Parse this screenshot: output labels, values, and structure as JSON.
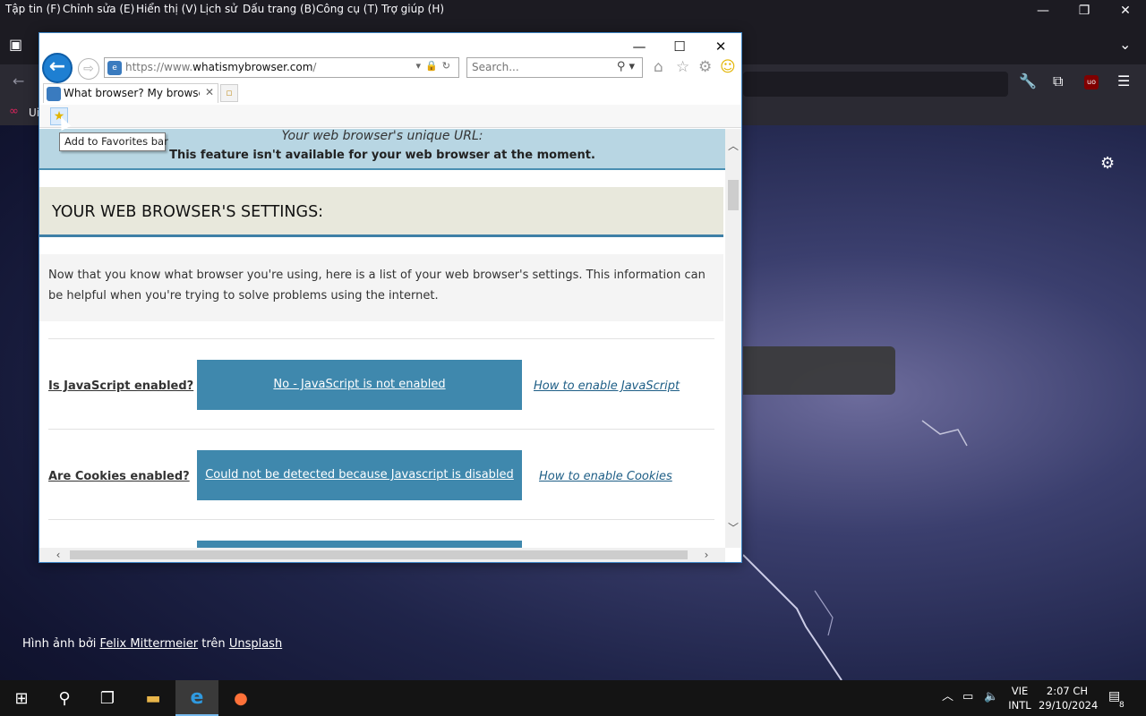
{
  "firefox": {
    "menu": [
      "Tập tin (F)",
      "Chỉnh sửa (E)",
      "Hiển thị (V)",
      "Lịch sử",
      "Dấu trang (B)",
      "Công cụ (T)",
      "Trợ giúp (H)"
    ],
    "bookmark_prefix": "Ui"
  },
  "desktop": {
    "credit_prefix": "Hình ảnh bởi",
    "credit_author": "Felix Mittermeier",
    "credit_mid": "trên",
    "credit_site": "Unsplash"
  },
  "ie": {
    "address_prefix": "https://www.",
    "address_host": "whatismybrowser.com",
    "address_suffix": "/",
    "search_placeholder": "Search...",
    "tab_title": "What browser? My browser...",
    "tooltip": "Add to Favorites bar"
  },
  "page": {
    "url_heading": "Your web browser's unique URL:",
    "url_notice": "This feature isn't available for your web browser at the moment.",
    "settings_heading": "YOUR WEB BROWSER'S SETTINGS:",
    "intro": "Now that you know what browser you're using, here is a list of your web browser's settings. This information can be helpful when you're trying to solve problems using the internet.",
    "rows": [
      {
        "question": "Is JavaScript enabled?",
        "answer": "No - JavaScript is not enabled",
        "link": "How to enable JavaScript"
      },
      {
        "question": "Are Cookies enabled?",
        "answer": "Could not be detected because Javascript is disabled",
        "link": "How to enable Cookies"
      }
    ]
  },
  "taskbar": {
    "lang_top": "VIE",
    "lang_bottom": "INTL",
    "time": "2:07 CH",
    "date": "29/10/2024",
    "notification_count": "8"
  },
  "colors": {
    "accent": "#3f88ad",
    "settings_border": "#3e7fa6",
    "url_band": "#b8d6e3"
  }
}
